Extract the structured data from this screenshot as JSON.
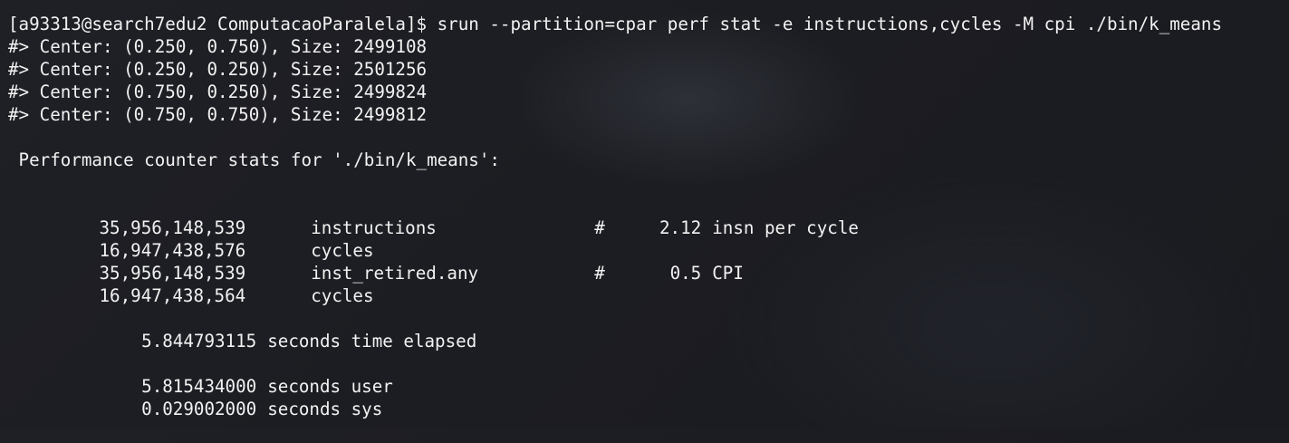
{
  "terminal": {
    "command_line": "[a93313@search7edu2 ComputacaoParalela]$ srun --partition=cpar perf stat -e instructions,cycles -M cpi ./bin/k_means",
    "centers": [
      "#> Center: (0.250, 0.750), Size: 2499108",
      "#> Center: (0.250, 0.250), Size: 2501256",
      "#> Center: (0.750, 0.250), Size: 2499824",
      "#> Center: (0.750, 0.750), Size: 2499812"
    ],
    "perf_header": " Performance counter stats for './bin/k_means':",
    "stats": [
      {
        "count": "35,956,148,539",
        "event": "instructions",
        "hash": "#",
        "metric_value": "2.12",
        "metric_unit": "insn per cycle"
      },
      {
        "count": "16,947,438,576",
        "event": "cycles",
        "hash": "",
        "metric_value": "",
        "metric_unit": ""
      },
      {
        "count": "35,956,148,539",
        "event": "inst_retired.any",
        "hash": "#",
        "metric_value": "0.5",
        "metric_unit": "CPI"
      },
      {
        "count": "16,947,438,564",
        "event": "cycles",
        "hash": "",
        "metric_value": "",
        "metric_unit": ""
      }
    ],
    "elapsed": {
      "value": "5.844793115",
      "label": "seconds time elapsed"
    },
    "user": {
      "value": "5.815434000",
      "label": "seconds user"
    },
    "sys": {
      "value": "0.029002000",
      "label": "seconds sys"
    }
  }
}
